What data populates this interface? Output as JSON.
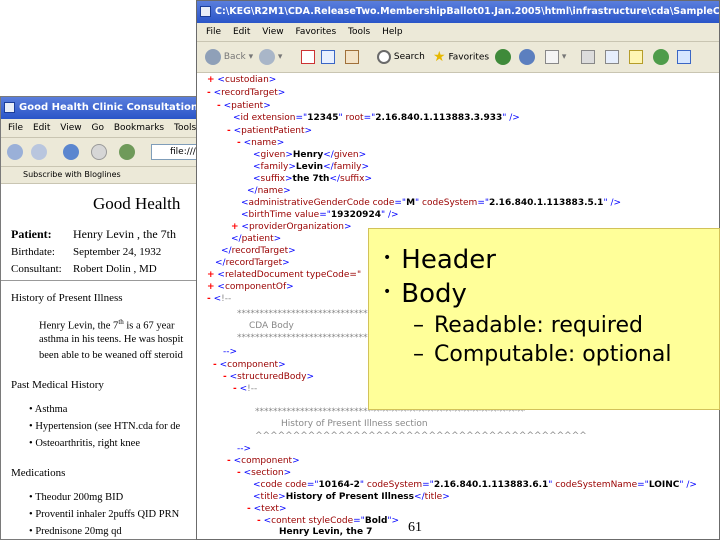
{
  "back_window": {
    "title": "Good Health Clinic Consultation Note",
    "menu": [
      "File",
      "Edit",
      "View",
      "Go",
      "Bookmarks",
      "Tools",
      "H"
    ],
    "address": "file:///C",
    "link": "Subscribe with Bloglines",
    "doc": {
      "heading": "Good Health",
      "patient_label": "Patient:",
      "patient_value": "Henry Levin , the 7th",
      "birthdate_label": "Birthdate:",
      "birthdate_value": "September 24, 1932",
      "consultant_label": "Consultant:",
      "consultant_value": "Robert Dolin , MD",
      "hpi_heading": "History of Present Illness",
      "hpi_line1": "Henry Levin, the 7",
      "hpi_sup": "th",
      "hpi_line1b": " is a 67 year",
      "hpi_line2": "asthma in his teens. He was hospit",
      "hpi_line3": "been able to be weaned off steroid",
      "pmh_heading": "Past Medical History",
      "pmh_items": [
        "Asthma",
        "Hypertension (see HTN.cda for de",
        "Osteoarthritis, right knee"
      ],
      "med_heading": "Medications",
      "med_items": [
        "Theodur 200mg BID",
        "Proventil inhaler 2puffs QID PRN",
        "Prednisone 20mg qd"
      ]
    }
  },
  "front_window": {
    "title": "C:\\KEG\\R2M1\\CDA.ReleaseTwo.MembershipBallot01.Jan.2005\\html\\infrastructure\\cda\\SampleCDADocumen",
    "menu": [
      "File",
      "Edit",
      "View",
      "Favorites",
      "Tools",
      "Help"
    ],
    "toolbar": {
      "back": "Back",
      "search": "Search",
      "favorites": "Favorites"
    },
    "xml": {
      "l1": {
        "tag": "custodian"
      },
      "l2": {
        "tag": "recordTarget"
      },
      "l3": {
        "tag": "patient"
      },
      "l4": {
        "tag": "id",
        "attr1": "extension",
        "val1": "12345",
        "attr2": "root",
        "val2": "2.16.840.1.113883.3.933"
      },
      "l5": {
        "tag": "patientPatient"
      },
      "l6": {
        "tag": "name"
      },
      "l7": {
        "tag": "given",
        "text": "Henry"
      },
      "l8": {
        "tag": "family",
        "text": "Levin"
      },
      "l9": {
        "tag": "suffix",
        "text": "the 7th"
      },
      "l10": {
        "tag": "name"
      },
      "l11": {
        "tag": "administrativeGenderCode",
        "attr1": "code",
        "val1": "M",
        "attr2": "codeSystem",
        "val2": "2.16.840.1.113883.5.1"
      },
      "l12": {
        "tag": "birthTime",
        "attr1": "value",
        "val1": "19320924"
      },
      "l13": {
        "tag": "providerOrganization"
      },
      "l14": {
        "tag": "patient"
      },
      "l15": {
        "tag": "recordTarget"
      },
      "l16": {
        "tag": "relatedDocument typeCode=\""
      },
      "l17": {
        "tag": "componentOf"
      },
      "l18": {
        "tag": "!--"
      },
      "c1": "**********************************",
      "c2": "CDA Body",
      "c3": "**********************************",
      "l19": {
        "text": "-->"
      },
      "l20": {
        "tag": "component"
      },
      "l21": {
        "tag": "structuredBody"
      },
      "l22": {
        "tag": "!--"
      },
      "c4": "************************************************************",
      "c5": "History of Present Illness section",
      "c6": "^^^^^^^^^^^^^^^^^^^^^^^^^^^^^^^^^^^^^^^^^^^^",
      "l23": {
        "text": "-->"
      },
      "l24": {
        "tag": "component"
      },
      "l25": {
        "tag": "section"
      },
      "l26": {
        "tag": "code",
        "attr1": "code",
        "val1": "10164-2",
        "attr2": "codeSystem",
        "val2": "2.16.840.1.113883.6.1",
        "attr3": "codeSystemName",
        "val3": "LOINC"
      },
      "l27": {
        "tag": "title",
        "text": "History of Present Illness"
      },
      "l28": {
        "tag": "text"
      },
      "l29": {
        "tag": "content",
        "attr1": "styleCode",
        "val1": "Bold"
      },
      "l30": {
        "text": "Henry Levin, the 7"
      }
    }
  },
  "overlay": {
    "bullets": [
      "Header",
      "Body"
    ],
    "sub": [
      "Readable: required",
      "Computable: optional"
    ]
  },
  "page_number": "61",
  "colors": {
    "overlay_bg": "#ffff99",
    "titlebar": "#2a55c8",
    "xml_markup": "#0000ff",
    "xml_tag": "#990000"
  }
}
